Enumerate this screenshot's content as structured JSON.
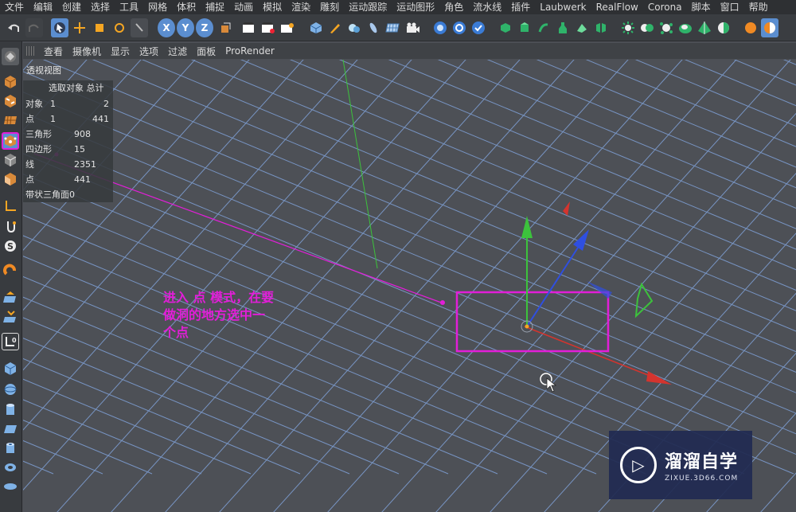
{
  "menu": [
    "文件",
    "编辑",
    "创建",
    "选择",
    "工具",
    "网格",
    "体积",
    "捕捉",
    "动画",
    "模拟",
    "渲染",
    "雕刻",
    "运动跟踪",
    "运动图形",
    "角色",
    "流水线",
    "插件",
    "Laubwerk",
    "RealFlow",
    "Corona",
    "脚本",
    "窗口",
    "帮助"
  ],
  "toolbar": {
    "undo_icon": "undo-arrow",
    "axis_x": "X",
    "axis_y": "Y",
    "axis_z": "Z"
  },
  "viewport_menu": [
    "查看",
    "摄像机",
    "显示",
    "选项",
    "过滤",
    "面板",
    "ProRender"
  ],
  "viewport": {
    "title": "透视视图",
    "stats": {
      "header": "选取对象 总计",
      "rows": [
        {
          "label": "对象",
          "selected": "1",
          "total": "2"
        },
        {
          "label": "点",
          "selected": "1",
          "total": "441"
        }
      ],
      "totals": [
        {
          "label": "三角形",
          "value": "908"
        },
        {
          "label": "四边形",
          "value": "15"
        },
        {
          "label": "线",
          "value": "2351"
        },
        {
          "label": "点",
          "value": "441"
        },
        {
          "label": "带状三角面",
          "value": "0"
        }
      ]
    },
    "annotation": "进入 点 模式，在要做洞的地方选中一个点"
  },
  "watermark": {
    "name": "溜溜自学",
    "url": "ZIXUE.3D66.COM"
  },
  "colors": {
    "annotation": "#e21ed8",
    "grid": "#7fa0d6",
    "axis_x": "#d4342e",
    "axis_y": "#3cc23c",
    "axis_z": "#2f4fe0",
    "highlight": "#5b8ed0"
  }
}
